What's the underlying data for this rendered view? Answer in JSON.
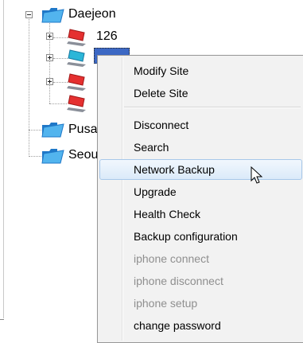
{
  "tree": {
    "root_label": "Daejeon",
    "child_1_label": "126",
    "sibling_1_label": "Pusan",
    "sibling_2_label": "Seoul"
  },
  "context_menu": {
    "items": [
      {
        "label": "Modify Site",
        "enabled": true
      },
      {
        "label": "Delete Site",
        "enabled": true
      },
      {
        "label": "Disconnect",
        "enabled": true
      },
      {
        "label": "Search",
        "enabled": true
      },
      {
        "label": "Network Backup",
        "enabled": true,
        "hovered": true
      },
      {
        "label": "Upgrade",
        "enabled": true
      },
      {
        "label": "Health Check",
        "enabled": true
      },
      {
        "label": "Backup configuration",
        "enabled": true
      },
      {
        "label": "iphone connect",
        "enabled": false
      },
      {
        "label": "iphone disconnect",
        "enabled": false
      },
      {
        "label": "iphone setup",
        "enabled": false
      },
      {
        "label": "change password",
        "enabled": true
      }
    ]
  },
  "icons": {
    "folder": "folder-icon",
    "device_disconnected": "red-computer-icon",
    "device_connected": "blue-computer-icon",
    "cursor": "mouse-pointer-icon"
  },
  "colors": {
    "selection": "#3c68c4",
    "menu_bg": "#f2f2f2",
    "disabled_text": "#8f8f8f",
    "device_red": "#e53030",
    "device_cyan": "#2bb6d8",
    "folder_blue": "#3aa0e0"
  }
}
